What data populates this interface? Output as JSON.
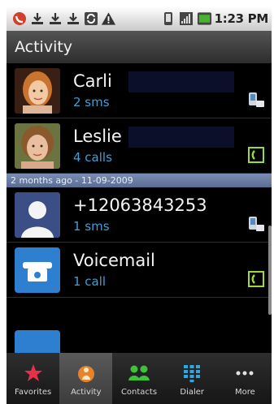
{
  "status_bar": {
    "time": "1:23 PM",
    "icons": [
      "no-call-icon",
      "download-icon",
      "download-icon",
      "download-icon",
      "sync-icon",
      "warning-icon",
      "vibrate-icon",
      "signal-icon",
      "battery-icon"
    ]
  },
  "title": "Activity",
  "rows": [
    {
      "name": "Carli",
      "detail": "2 sms",
      "type_icon": "sms-icon",
      "avatar": "photo-avatar"
    },
    {
      "name": "Leslie",
      "detail": "4 calls",
      "type_icon": "call-icon",
      "avatar": "photo-avatar"
    },
    {
      "name": "+12063843253",
      "detail": "1 sms",
      "type_icon": "sms-icon",
      "avatar": "default-contact-avatar"
    },
    {
      "name": "Voicemail",
      "detail": "1 call",
      "type_icon": "call-icon",
      "avatar": "voicemail-avatar"
    }
  ],
  "section_header": "2 months ago - 11-09-2009",
  "tabs": [
    {
      "label": "Favorites",
      "icon": "star-icon",
      "active": false
    },
    {
      "label": "Activity",
      "icon": "activity-icon",
      "active": true
    },
    {
      "label": "Contacts",
      "icon": "contacts-icon",
      "active": false
    },
    {
      "label": "Dialer",
      "icon": "dialpad-icon",
      "active": false
    },
    {
      "label": "More",
      "icon": "more-icon",
      "active": false
    }
  ],
  "colors": {
    "accent_blue": "#3fa0d8",
    "call_green": "#9bdc3c",
    "favorite_red": "#e8304a"
  }
}
